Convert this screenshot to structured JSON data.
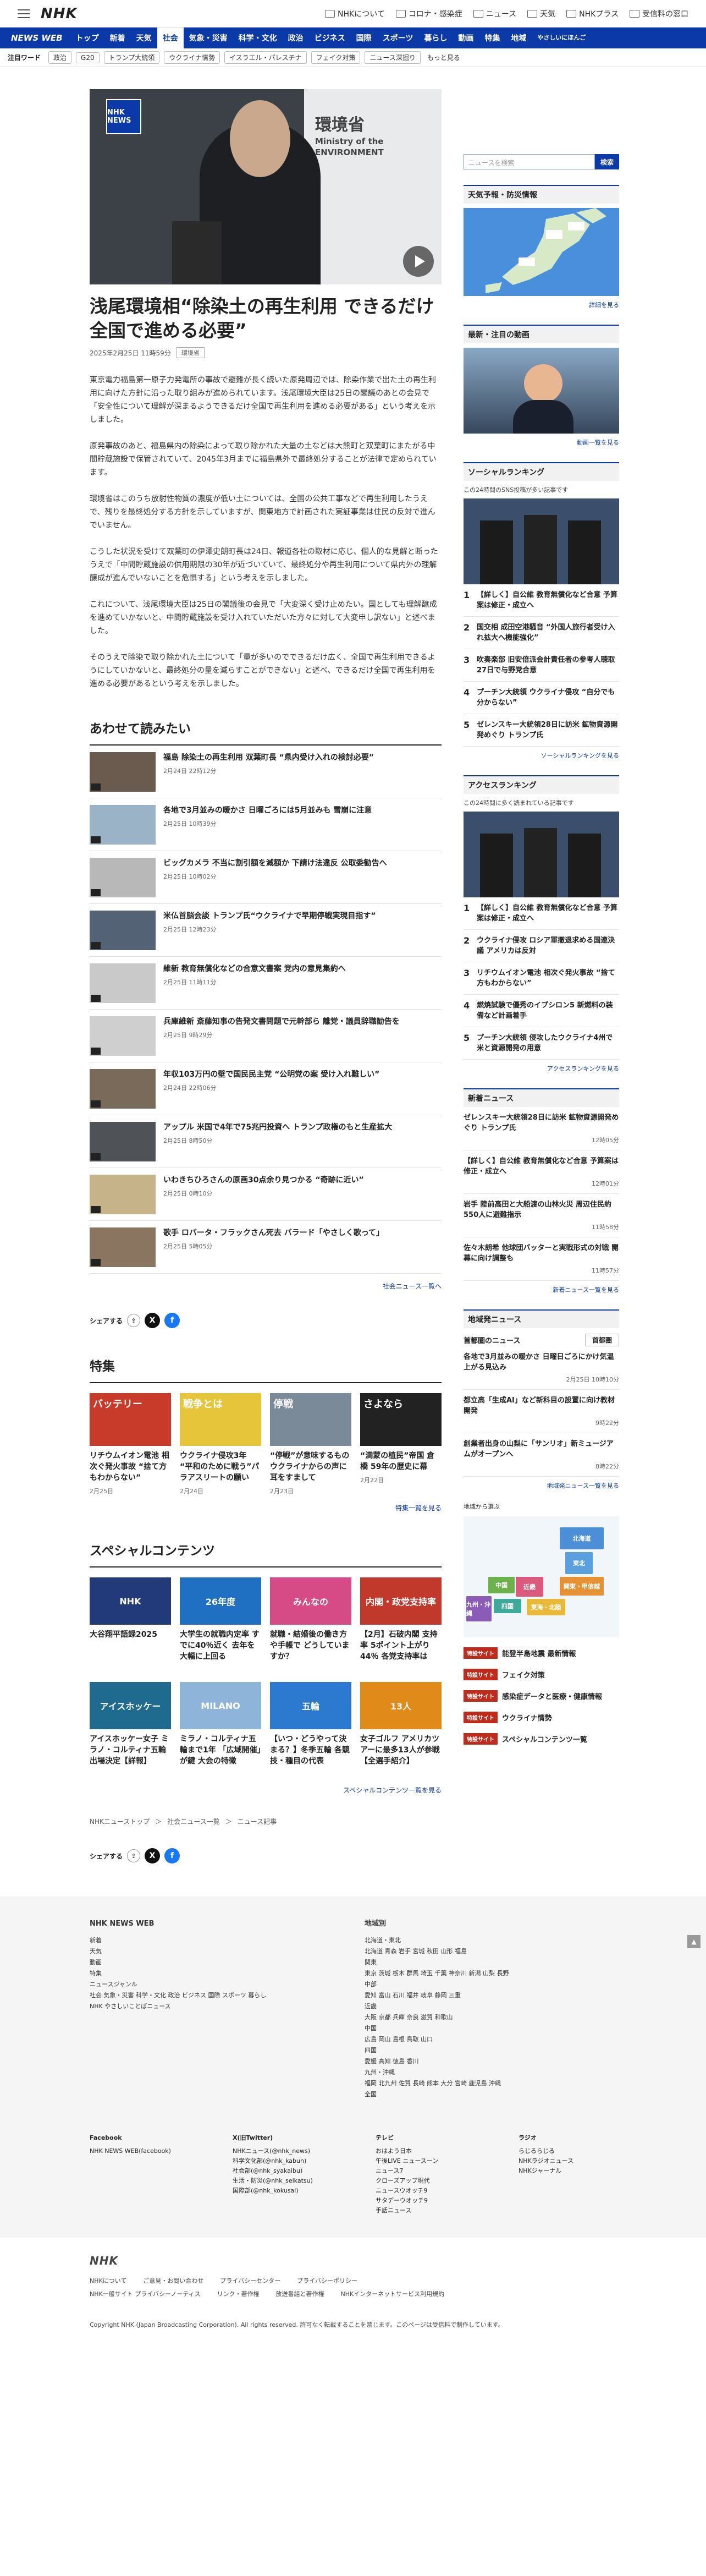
{
  "top": {
    "links": [
      "NHKについて",
      "コロナ・感染症",
      "ニュース",
      "天気",
      "NHKプラス",
      "受信料の窓口"
    ]
  },
  "nav": {
    "brand": "NEWS WEB",
    "items": [
      "トップ",
      "新着",
      "天気",
      "社会",
      "気象・災害",
      "科学・文化",
      "政治",
      "ビジネス",
      "国際",
      "スポーツ",
      "暮らし",
      "動画",
      "特集",
      "地域"
    ],
    "last": "やさしいにほんご"
  },
  "trend": {
    "label": "注目ワード",
    "chips": [
      "政治",
      "G20",
      "トランプ大統領",
      "ウクライナ情勢",
      "イスラエル・パレスチナ",
      "フェイク対策",
      "ニュース深掘り"
    ],
    "more": "もっと見る"
  },
  "hero": {
    "badge": "NHK NEWS",
    "wall": [
      "環境省",
      "Ministry of the",
      "ENVIRONMENT"
    ]
  },
  "article": {
    "title": "浅尾環境相“除染土の再生利用 できるだけ全国で進める必要”",
    "date": "2025年2月25日 11時59分",
    "tag": "環境省",
    "paragraphs": [
      "東京電力福島第一原子力発電所の事故で避難が長く続いた原発周辺では、除染作業で出た土の再生利用に向けた方針に沿った取り組みが進められています。浅尾環境大臣は25日の閣議のあとの会見で「安全性について理解が深まるようできるだけ全国で再生利用を進める必要がある」という考えを示しました。",
      "原発事故のあと、福島県内の除染によって取り除かれた大量の土などは大熊町と双葉町にまたがる中間貯蔵施設で保管されていて、2045年3月までに福島県外で最終処分することが法律で定められています。",
      "環境省はこのうち放射性物質の濃度が低い土については、全国の公共工事などで再生利用したうえで、残りを最終処分する方針を示していますが、関東地方で計画された実証事業は住民の反対で進んでいません。",
      "こうした状況を受けて双葉町の伊澤史朗町長は24日、報道各社の取材に応じ、個人的な見解と断ったうえで「中間貯蔵施設の供用期限の30年が近づいていて、最終処分や再生利用について県内外の理解醸成が進んでいないことを危惧する」という考えを示しました。",
      "これについて、浅尾環境大臣は25日の閣議後の会見で「大変深く受け止めたい。国としても理解醸成を進めていかないと、中間貯蔵施設を受け入れていただいた方々に対して大変申し訳ない」と述べました。",
      "そのうえで除染で取り除かれた土について「量が多いのでできるだけ広く、全国で再生利用できるようにしていかないと、最終処分の量を減らすことができない」と述べ、できるだけ全国で再生利用を進める必要があるという考えを示しました。"
    ]
  },
  "related": {
    "heading": "あわせて読みたい",
    "items": [
      {
        "t": "福島 除染土の再生利用 双葉町長 “県内受け入れの検討必要”",
        "d": "2月24日 22時12分"
      },
      {
        "t": "各地で3月並みの暖かさ 日曜ごろには5月並みも 雪崩に注意",
        "d": "2月25日 10時39分"
      },
      {
        "t": "ビッグカメラ 不当に割引額を減額か 下請け法違反 公取委勧告へ",
        "d": "2月25日 10時02分"
      },
      {
        "t": "米仏首脳会談 トランプ氏“ウクライナで早期停戦実現目指す”",
        "d": "2月25日 12時23分"
      },
      {
        "t": "維新 教育無償化などの合意文書案 党内の意見集約へ",
        "d": "2月25日 11時11分"
      },
      {
        "t": "兵庫維新 斎藤知事の告発文書問題で元幹部ら 離党・議員辞職勧告を",
        "d": "2月25日 9時29分"
      },
      {
        "t": "年収103万円の壁で国民民主党 “公明党の案 受け入れ難しい”",
        "d": "2月24日 22時06分"
      },
      {
        "t": "アップル 米国で4年で75兆円投資へ トランプ政権のもと生産拡大",
        "d": "2月25日 8時50分"
      },
      {
        "t": "いわきちひろさんの原画30点余り見つかる “奇跡に近い”",
        "d": "2月25日 0時10分"
      },
      {
        "t": "歌手 ロバータ・フラックさん死去 バラード「やさしく歌って」",
        "d": "2月25日 5時05分"
      }
    ],
    "more": "社会ニュース一覧へ"
  },
  "share": {
    "label": "シェアする"
  },
  "feature": {
    "heading": "特集",
    "more": "特集一覧を見る",
    "items": [
      {
        "img": "バッテリー",
        "t": "リチウムイオン電池 相次ぐ発火事故 “捨て方もわからない”",
        "d": "2月25日"
      },
      {
        "img": "戦争とは",
        "t": "ウクライナ侵攻3年 “平和のために戦う”パラアスリートの願い",
        "d": "2月24日"
      },
      {
        "img": "停戦",
        "t": "“停戦”が意味するもの ウクライナからの声に耳をすまして",
        "d": "2月23日"
      },
      {
        "img": "さよなら",
        "t": "“満蒙の植民”帝国 倉橋 59年の歴史に幕",
        "d": "2月22日"
      }
    ]
  },
  "special": {
    "heading": "スペシャルコンテンツ",
    "more": "スペシャルコンテンツ一覧を見る",
    "items": [
      {
        "img": "NHK",
        "t": "大谷翔平語録2025"
      },
      {
        "img": "26年度",
        "t": "大学生の就職内定率 すでに40％近く 去年を大幅に上回る"
      },
      {
        "img": "みんなの",
        "t": "就職・結婚後の働き方や手帳で どうしていますか？"
      },
      {
        "img": "内閣・政党支持率",
        "t": "【2月】石破内閣 支持率 5ポイント上がり44％ 各党支持率は"
      },
      {
        "img": "アイスホッケー",
        "t": "アイスホッケー女子 ミラノ・コルティナ五輪出場決定【詳報】"
      },
      {
        "img": "MILANO",
        "t": "ミラノ・コルティナ五輪まで1年 「広域開催」が鍵 大会の特徴"
      },
      {
        "img": "五輪",
        "t": "【いつ・どうやって決まる？】冬季五輪 各競技・種目の代表"
      },
      {
        "img": "13人",
        "t": "女子ゴルフ アメリカツアーに最多13人が参戦【全選手紹介】"
      }
    ]
  },
  "breadcrumb": [
    "NHKニューストップ",
    "社会ニュース一覧",
    "ニュース記事"
  ],
  "sidebar": {
    "search_placeholder": "ニュースを検索",
    "search_btn": "検索",
    "weather": {
      "h": "天気予報・防災情報",
      "link": "詳細を見る"
    },
    "video": {
      "h": "最新・注目の動画",
      "link": "動画一覧を見る"
    },
    "social": {
      "h": "ソーシャルランキング",
      "sub": "この24時間のSNS投稿が多い記事です",
      "items": [
        "【詳しく】自公維 教育無償化など合意 予算案は修正・成立へ",
        "国交相 成田空港騒音 “外国人旅行者受け入れ拡大へ機能強化”",
        "吹奏楽部 旧安倍派会計責任者の参考人聴取 27日で与野党合意",
        "プーチン大統領 ウクライナ侵攻 “自分でも分からない”",
        "ゼレンスキー大統領28日に訪米 鉱物資源開発めぐり トランプ氏"
      ],
      "link": "ソーシャルランキングを見る"
    },
    "access": {
      "h": "アクセスランキング",
      "sub": "この24時間に多く読まれている記事です",
      "items": [
        "【詳しく】自公維 教育無償化など合意 予算案は修正・成立へ",
        "ウクライナ侵攻 ロシア軍撤退求める国連決議 アメリカは反対",
        "リチウムイオン電池 相次ぐ発火事故 “捨て方もわからない”",
        "燃焼試験で優秀のイプシロン5 新燃料の装備など計画着手",
        "プーチン大統領 侵攻したウクライナ4州で米と資源開発の用意"
      ],
      "link": "アクセスランキングを見る"
    },
    "new": {
      "h": "新着ニュース",
      "items": [
        {
          "t": "ゼレンスキー大統領28日に訪米 鉱物資源開発めぐり トランプ氏",
          "d": "12時05分"
        },
        {
          "t": "【詳しく】自公維 教育無償化など合意 予算案は修正・成立へ",
          "d": "12時01分"
        },
        {
          "t": "岩手 陸前高田と大船渡の山林火災 周辺住民約550人に避難指示",
          "d": "11時58分"
        },
        {
          "t": "佐々木朗希 他球団バッターと実戦形式の対戦 開幕に向け調整も",
          "d": "11時57分"
        }
      ],
      "link": "新着ニュース一覧を見る"
    },
    "local": {
      "h": "地域発ニュース",
      "region": "首都圏のニュース",
      "select": "首都圏",
      "items": [
        {
          "t": "各地で3月並みの暖かさ 日曜日ごろにかけ気温上がる見込み",
          "d": "2月25日 10時10分"
        },
        {
          "t": "都立高「生成AI」など新科目の設置に向け教材開発",
          "d": "9時22分"
        },
        {
          "t": "創業者出身の山梨に「サンリオ」新ミュージアムがオープンへ",
          "d": "8時22分"
        }
      ],
      "link": "地域発ニュース一覧を見る",
      "map_label": "地域から選ぶ",
      "regions": [
        "北海道",
        "東北",
        "関東・甲信越",
        "東海・北陸",
        "近畿",
        "中国",
        "四国",
        "九州・沖縄"
      ]
    },
    "banners": [
      {
        "b": "特設サイト",
        "t": "能登半島地震 最新情報"
      },
      {
        "b": "特設サイト",
        "t": "フェイク対策"
      },
      {
        "b": "特設サイト",
        "t": "感染症データと医療・健康情報"
      },
      {
        "b": "特設サイト",
        "t": "ウクライナ情勢"
      },
      {
        "b": "特設サイト",
        "t": "スペシャルコンテンツ一覧"
      }
    ]
  },
  "footer": {
    "left_title": "NHK NEWS WEB",
    "left": [
      "新着",
      "天気",
      "動画",
      "特集",
      "ニュースジャンル",
      "社会 気象・災害 科学・文化 政治 ビジネス 国際 スポーツ 暮らし",
      "NHK やさしいことばニュース"
    ],
    "right_title": "地域別",
    "right": [
      "北海道・東北",
      "北海道 青森 岩手 宮城 秋田 山形 福島",
      "関東",
      "東京 茨城 栃木 群馬 埼玉 千葉 神奈川 新潟 山梨 長野",
      "中部",
      "愛知 富山 石川 福井 岐阜 静岡 三重",
      "近畿",
      "大阪 京都 兵庫 奈良 滋賀 和歌山",
      "中国",
      "広島 岡山 島根 鳥取 山口",
      "四国",
      "愛媛 高知 徳島 香川",
      "九州・沖縄",
      "福岡 北九州 佐賀 長崎 熊本 大分 宮崎 鹿児島 沖縄",
      "全国"
    ],
    "sns": [
      {
        "h": "Facebook",
        "l": [
          "NHK NEWS WEB(facebook)"
        ]
      },
      {
        "h": "X(旧Twitter)",
        "l": [
          "NHKニュース(@nhk_news)",
          "科学文化部(@nhk_kabun)",
          "社会部(@nhk_syakaibu)",
          "生活・防災(@nhk_seikatsu)",
          "国際部(@nhk_kokusai)"
        ]
      },
      {
        "h": "テレビ",
        "l": [
          "おはよう日本",
          "午後LIVE ニュースーン",
          "ニュース7",
          "クローズアップ現代",
          "ニュースウオッチ9",
          "サタデーウオッチ9",
          "手話ニュース"
        ]
      },
      {
        "h": "ラジオ",
        "l": [
          "らじるらじる",
          "NHKラジオニュース",
          "NHKジャーナル"
        ]
      }
    ],
    "bottom": [
      "NHKについて",
      "ご意見・お問い合わせ",
      "プライバシーセンター",
      "プライバシーポリシー",
      "NHK一般サイト プライバシーノーティス",
      "リンク・著作権",
      "放送番組と著作権",
      "NHKインターネットサービス利用規約"
    ],
    "copyright": "Copyright NHK (Japan Broadcasting Corporation). All rights reserved. 許可なく転載することを禁じます。このページは受信料で制作しています。"
  },
  "colors": {
    "brand": "#0b3aa8",
    "accent": "#c02a1a"
  }
}
